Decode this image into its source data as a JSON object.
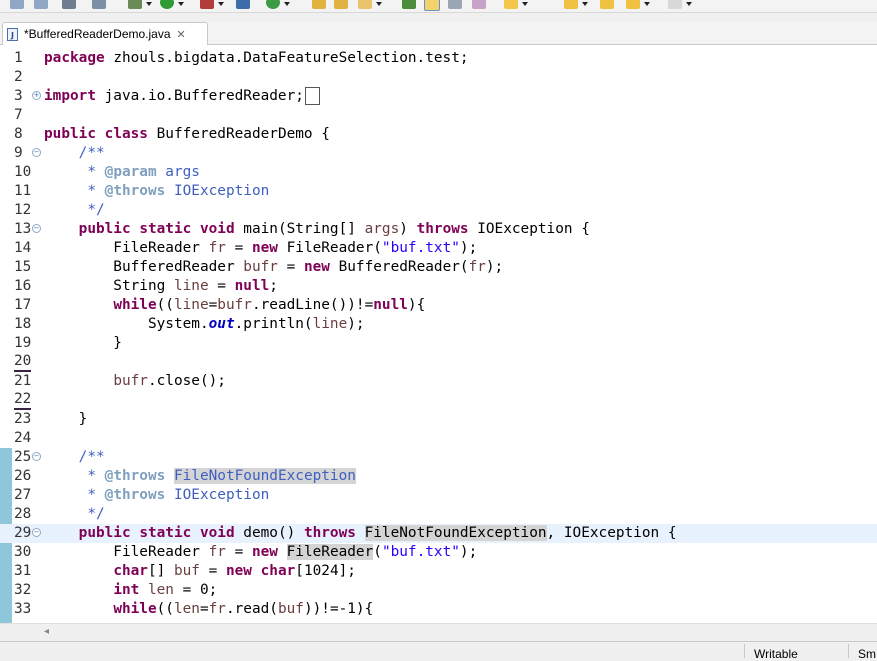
{
  "tab": {
    "title": "*BufferedReaderDemo.java",
    "close_glyph": "✕",
    "icon_letter": "J"
  },
  "editor": {
    "lines": [
      {
        "num": "1",
        "parts": [
          {
            "t": "package",
            "c": "kw"
          },
          {
            "t": " zhouls.bigdata.DataFeatureSelection.test;"
          }
        ]
      },
      {
        "num": "2",
        "parts": []
      },
      {
        "num": "3",
        "fold": "plus",
        "parts": [
          {
            "t": "import",
            "c": "kw"
          },
          {
            "t": " java.io.BufferedReader;"
          },
          {
            "t": " ",
            "c": "boxed"
          }
        ]
      },
      {
        "num": "7",
        "parts": []
      },
      {
        "num": "8",
        "parts": [
          {
            "t": "public",
            "c": "kw"
          },
          {
            "t": " "
          },
          {
            "t": "class",
            "c": "kw"
          },
          {
            "t": " BufferedReaderDemo {"
          }
        ]
      },
      {
        "num": "9",
        "fold": "minus",
        "parts": [
          {
            "t": "    /**",
            "c": "jd"
          }
        ]
      },
      {
        "num": "10",
        "parts": [
          {
            "t": "     * ",
            "c": "jd"
          },
          {
            "t": "@param",
            "c": "tag"
          },
          {
            "t": " args",
            "c": "jd"
          }
        ]
      },
      {
        "num": "11",
        "parts": [
          {
            "t": "     * ",
            "c": "jd"
          },
          {
            "t": "@throws",
            "c": "tag"
          },
          {
            "t": " IOException",
            "c": "jd"
          }
        ]
      },
      {
        "num": "12",
        "parts": [
          {
            "t": "     */",
            "c": "jd"
          }
        ]
      },
      {
        "num": "13",
        "fold": "minus",
        "parts": [
          {
            "t": "    "
          },
          {
            "t": "public",
            "c": "kw"
          },
          {
            "t": " "
          },
          {
            "t": "static",
            "c": "kw"
          },
          {
            "t": " "
          },
          {
            "t": "void",
            "c": "kw"
          },
          {
            "t": " main(String[] "
          },
          {
            "t": "args",
            "c": "local"
          },
          {
            "t": ") "
          },
          {
            "t": "throws",
            "c": "kw"
          },
          {
            "t": " IOException {"
          }
        ]
      },
      {
        "num": "14",
        "parts": [
          {
            "t": "        FileReader "
          },
          {
            "t": "fr",
            "c": "local"
          },
          {
            "t": " = "
          },
          {
            "t": "new",
            "c": "kw"
          },
          {
            "t": " FileReader("
          },
          {
            "t": "\"buf.txt\"",
            "c": "str"
          },
          {
            "t": ");"
          }
        ]
      },
      {
        "num": "15",
        "parts": [
          {
            "t": "        BufferedReader "
          },
          {
            "t": "bufr",
            "c": "local"
          },
          {
            "t": " = "
          },
          {
            "t": "new",
            "c": "kw"
          },
          {
            "t": " BufferedReader("
          },
          {
            "t": "fr",
            "c": "local"
          },
          {
            "t": ");"
          }
        ]
      },
      {
        "num": "16",
        "parts": [
          {
            "t": "        String "
          },
          {
            "t": "line",
            "c": "local"
          },
          {
            "t": " = "
          },
          {
            "t": "null",
            "c": "kw"
          },
          {
            "t": ";"
          }
        ]
      },
      {
        "num": "17",
        "parts": [
          {
            "t": "        "
          },
          {
            "t": "while",
            "c": "kw"
          },
          {
            "t": "(("
          },
          {
            "t": "line",
            "c": "local"
          },
          {
            "t": "="
          },
          {
            "t": "bufr",
            "c": "local"
          },
          {
            "t": ".readLine())!="
          },
          {
            "t": "null",
            "c": "kw"
          },
          {
            "t": "){"
          }
        ]
      },
      {
        "num": "18",
        "parts": [
          {
            "t": "            System."
          },
          {
            "t": "out",
            "c": "static-field"
          },
          {
            "t": ".println("
          },
          {
            "t": "line",
            "c": "local"
          },
          {
            "t": ");"
          }
        ]
      },
      {
        "num": "19",
        "parts": [
          {
            "t": "        }"
          }
        ]
      },
      {
        "num": "20",
        "underline": true,
        "parts": []
      },
      {
        "num": "21",
        "parts": [
          {
            "t": "        "
          },
          {
            "t": "bufr",
            "c": "local"
          },
          {
            "t": ".close();"
          }
        ]
      },
      {
        "num": "22",
        "underline": true,
        "parts": []
      },
      {
        "num": "23",
        "parts": [
          {
            "t": "    }"
          }
        ]
      },
      {
        "num": "24",
        "parts": []
      },
      {
        "num": "25",
        "fold": "minus",
        "parts": [
          {
            "t": "    /**",
            "c": "jd"
          }
        ]
      },
      {
        "num": "26",
        "parts": [
          {
            "t": "     * ",
            "c": "jd"
          },
          {
            "t": "@throws",
            "c": "tag"
          },
          {
            "t": " ",
            "c": "jd"
          },
          {
            "t": "FileNotFoundException",
            "c": "hlt"
          }
        ]
      },
      {
        "num": "27",
        "parts": [
          {
            "t": "     * ",
            "c": "jd"
          },
          {
            "t": "@throws",
            "c": "tag"
          },
          {
            "t": " IOException",
            "c": "jd"
          }
        ]
      },
      {
        "num": "28",
        "parts": [
          {
            "t": "     */",
            "c": "jd"
          }
        ]
      },
      {
        "num": "29",
        "fold": "minus",
        "current": true,
        "parts": [
          {
            "t": "    "
          },
          {
            "t": "public",
            "c": "kw"
          },
          {
            "t": " "
          },
          {
            "t": "static",
            "c": "kw"
          },
          {
            "t": " "
          },
          {
            "t": "void",
            "c": "kw"
          },
          {
            "t": " demo() "
          },
          {
            "t": "throws",
            "c": "kw"
          },
          {
            "t": " "
          },
          {
            "t": "FileNotFoundException",
            "c": "hl"
          },
          {
            "t": ", IOException {"
          }
        ]
      },
      {
        "num": "30",
        "parts": [
          {
            "t": "        FileReader "
          },
          {
            "t": "fr",
            "c": "local"
          },
          {
            "t": " = "
          },
          {
            "t": "new",
            "c": "kw"
          },
          {
            "t": " "
          },
          {
            "t": "FileReader",
            "c": "hl"
          },
          {
            "t": "("
          },
          {
            "t": "\"buf.txt\"",
            "c": "str"
          },
          {
            "t": ");"
          }
        ]
      },
      {
        "num": "31",
        "parts": [
          {
            "t": "        "
          },
          {
            "t": "char",
            "c": "kw"
          },
          {
            "t": "[] "
          },
          {
            "t": "buf",
            "c": "local"
          },
          {
            "t": " = "
          },
          {
            "t": "new",
            "c": "kw"
          },
          {
            "t": " "
          },
          {
            "t": "char",
            "c": "kw"
          },
          {
            "t": "[1024];"
          }
        ]
      },
      {
        "num": "32",
        "parts": [
          {
            "t": "        "
          },
          {
            "t": "int",
            "c": "kw"
          },
          {
            "t": " "
          },
          {
            "t": "len",
            "c": "local"
          },
          {
            "t": " = 0;"
          }
        ]
      },
      {
        "num": "33",
        "parts": [
          {
            "t": "        "
          },
          {
            "t": "while",
            "c": "kw"
          },
          {
            "t": "(("
          },
          {
            "t": "len",
            "c": "local"
          },
          {
            "t": "="
          },
          {
            "t": "fr",
            "c": "local"
          },
          {
            "t": ".read("
          },
          {
            "t": "buf",
            "c": "local"
          },
          {
            "t": "))!=-1){"
          }
        ]
      }
    ]
  },
  "scrollbar": {
    "left_glyph": "◂"
  },
  "status": {
    "writable": "Writable",
    "insert": "Sm"
  },
  "colors": {
    "keyword": "#7f0055",
    "string": "#2a00ff",
    "javadoc": "#3f5fbf",
    "javadoc_tag": "#7f9fbf",
    "local_var": "#6a3e3e",
    "current_line": "#e8f2fe",
    "change_bar": "#8ec7da"
  }
}
